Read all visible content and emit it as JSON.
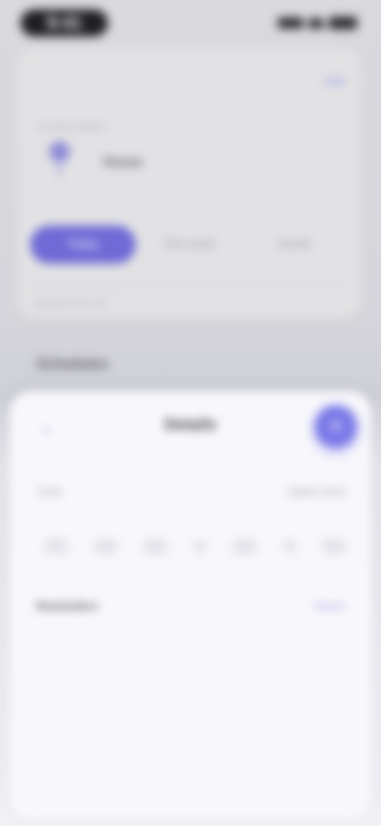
{
  "status_bar": {
    "time": "9:41",
    "icons": [
      "signal-icon",
      "wifi-icon",
      "battery-icon"
    ]
  },
  "top_card": {
    "link_label": "Edit",
    "location_caption": "Current location",
    "location_name": "Home",
    "segments": [
      {
        "label": "Today",
        "active": true
      },
      {
        "label": "This week",
        "active": false
      },
      {
        "label": "Month",
        "active": false
      }
    ],
    "footer_text": "Updated just now"
  },
  "section": {
    "label": "Schedules"
  },
  "sheet": {
    "back_icon": "chevron-left-icon",
    "title": "Details",
    "action_icon": "plus-icon",
    "row1": {
      "label": "Time",
      "value": "Select time"
    },
    "row2": {
      "label": "Reminders",
      "value": "Never"
    }
  },
  "colors": {
    "accent": "#6f6ad6",
    "accent_button": "#7a78e8",
    "sheet_background": "#f8f8fc"
  }
}
